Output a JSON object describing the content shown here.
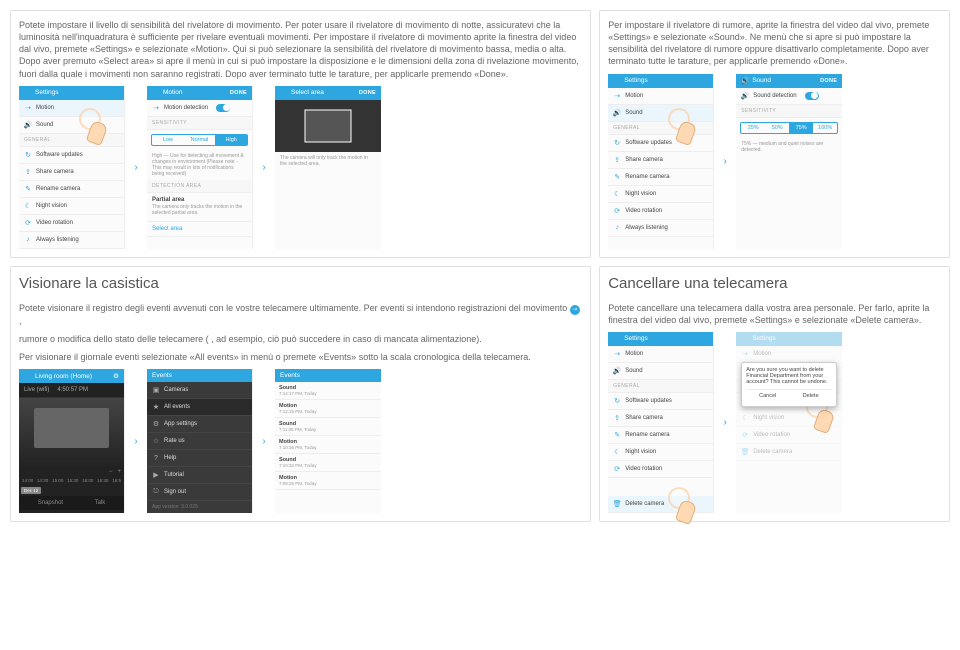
{
  "top": {
    "left_text": "Potete impostare il livello di sensibilità del rivelatore di movimento. Per poter usare il rivelatore di movimento di notte, assicuratevi che la luminosità nell'inquadratura è sufficiente per rivelare eventuali movimenti. Per impostare il rivelatore di movimento aprite la finestra del video dal vivo, premete «Settings» e selezionate «Motion». Qui si può selezionare la sensibilità del rivelatore di movimento bassa, media o alta. Dopo aver premuto «Select area» si apre il menù in cui si può impostare la disposizione e le dimensioni della zona di rivelazione movimento, fuori dalla quale i movimenti non saranno registrati. Dopo aver terminato tutte le tarature, per applicarle premendo «Done».",
    "right_text": "Per impostare il rivelatore di rumore, aprite la finestra del video dal vivo, premete «Settings» e selezionate «Sound». Ne menù che si apre si può impostare la sensibilità del rivelatore di rumore oppure disattivarlo completamente. Dopo aver terminato tutte le tarature, per applicarle premendo «Done».",
    "hdr_settings": "Settings",
    "hdr_motion": "Motion",
    "hdr_sound": "Sound",
    "hdr_select": "Select area",
    "done": "DONE",
    "menu_motion": "Motion",
    "menu_sound": "Sound",
    "menu_general": "GENERAL",
    "menu_sw": "Software updates",
    "menu_share": "Share camera",
    "menu_rename": "Rename camera",
    "menu_night": "Night vision",
    "menu_rot": "Video rotation",
    "menu_always": "Always listening",
    "sensitivity": "SENSITIVITY",
    "seg_low": "Low",
    "seg_normal": "Normal",
    "seg_high": "High",
    "high_note": "High — Use for detecting all movement & changes in environment (Please note - This may result in lots of notifications being received)",
    "det_area": "DETECTION AREA",
    "partial": "Partial area",
    "partial_note": "The camera only tracks the motion in the selected partial area.",
    "select_area": "Select area",
    "select_note": "The camera will only track the motion in the selected area.",
    "motion_det": "Motion detection",
    "sound_det": "Sound detection",
    "seg_25": "25%",
    "seg_50": "50%",
    "seg_75": "75%",
    "seg_100": "100%",
    "snd_note": "75% — medium and quiet noises are detected."
  },
  "mid": {
    "title_l": "Visionare la casistica",
    "text_l1": "Potete visionare il registro degli eventi avvenuti con le vostre telecamere ultimamente. Per eventi si intendono registrazioni del movimento",
    "text_l2": "rumore          o modifica dello stato delle telecamere (           , ad esempio, ciò può succedere in caso di mancata alimentazione).",
    "text_l3": "Per visionare il giornale eventi selezionate «All events» in menù o premete «Events» sotto la scala cronologica della telecamera.",
    "title_r": "Cancellare una telecamera",
    "text_r": "Potete cancellare una telecamera dalla vostra area personale. Per farlo, aprite la finestra del video dal vivo, premete «Settings» e selezionate «Delete camera».",
    "live_title": "Living room (Home)",
    "live_status": "Live (wifi)",
    "live_time": "4:50:57 PM",
    "tl": [
      "14:00",
      "14:30",
      "15:00",
      "15:30",
      "16:00",
      "16:30",
      "16:5"
    ],
    "tag": "Dec 12",
    "snap": "Snapshot",
    "talk": "Talk",
    "hdr_events": "Events",
    "menu_cam": "Cameras",
    "menu_all": "All events",
    "menu_app": "App settings",
    "menu_rate": "Rate us",
    "menu_help": "Help",
    "menu_tut": "Tutorial",
    "menu_out": "Sign out",
    "appv": "App version: 3.0.025",
    "ev": [
      {
        "k": "Sound",
        "t": "7:14:17 PM, Today"
      },
      {
        "k": "Motion",
        "t": "7:12:15 PM, Today"
      },
      {
        "k": "Sound",
        "t": "7:11:05 PM, Today"
      },
      {
        "k": "Motion",
        "t": "7:10:36 PM, Today"
      },
      {
        "k": "Sound",
        "t": "7:10:32 PM, Today"
      },
      {
        "k": "Motion",
        "t": "7:09:25 PM, Today"
      }
    ],
    "menu_delete": "Delete camera",
    "dlg_q": "Are you sure you want to delete Financial Department from your account? This cannot be undone.",
    "dlg_cancel": "Cancel",
    "dlg_del": "Delete"
  }
}
